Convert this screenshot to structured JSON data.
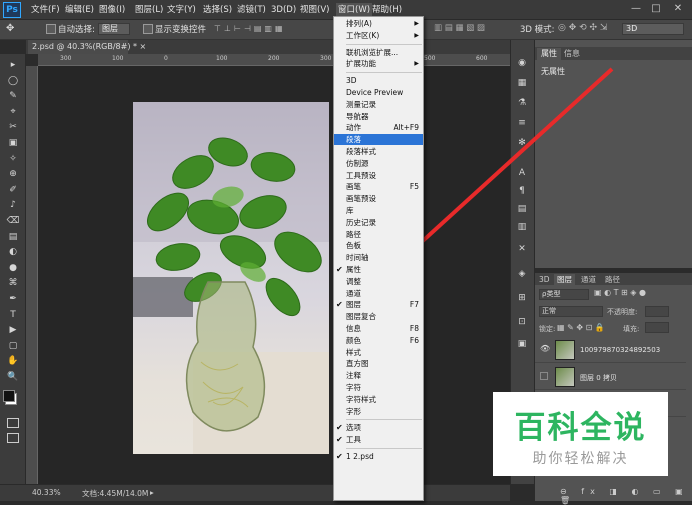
{
  "app": {
    "logo": "Ps"
  },
  "menubar": {
    "items": [
      "文件(F)",
      "编辑(E)",
      "图像(I)",
      "图层(L)",
      "文字(Y)",
      "选择(S)",
      "滤镜(T)",
      "3D(D)",
      "视图(V)",
      "窗口(W)",
      "帮助(H)"
    ],
    "active_index": 9,
    "controls": [
      "—",
      "□",
      "✕"
    ]
  },
  "options_bar": {
    "auto_select_label": "自动选择:",
    "auto_select_value": "图层",
    "show_transform_label": "显示变换控件",
    "mode_3d_label": "3D 模式:",
    "workspace_value": "3D"
  },
  "document": {
    "tab_label": "2.psd @ 40.3%(RGB/8#) *",
    "tab_close": "×",
    "ruler_ticks": [
      "300",
      "100",
      "0",
      "100",
      "200",
      "300",
      "400",
      "500",
      "600"
    ]
  },
  "status": {
    "zoom": "40.33%",
    "doc_info": "文档:4.45M/14.0M"
  },
  "toolbox": {
    "icons": [
      "▸",
      "◯",
      "✎",
      "⌖",
      "✂",
      "▣",
      "✧",
      "⊕",
      "✐",
      "♪",
      "⌫",
      "▤",
      "◐",
      "●",
      "⌘",
      "✒",
      "T",
      "▶",
      "▢",
      "✋",
      "🔍"
    ]
  },
  "panel_strip": {
    "icons": [
      "◉",
      "▦",
      "⚗",
      "≡",
      "✻",
      "A",
      "¶",
      "▤",
      "▥",
      "✕",
      "◈",
      "⊞",
      "⊡",
      "▣"
    ]
  },
  "properties": {
    "tabs": [
      "属性",
      "信息"
    ],
    "active_tab": 0,
    "content": "无属性"
  },
  "layers": {
    "tabs": [
      "3D",
      "图层",
      "通道",
      "路径"
    ],
    "active_tab": 1,
    "filter_label": "ρ类型",
    "blend_mode": "正常",
    "opacity_label": "不透明度:",
    "lock_label": "锁定:",
    "fill_label": "填充:",
    "rows": [
      {
        "name": "100979870324892503",
        "visible": true
      },
      {
        "name": "图层 0 拷贝",
        "visible": false
      },
      {
        "name": "",
        "visible": false
      }
    ],
    "footer_icons": [
      "⊖",
      "fx",
      "◨",
      "◐",
      "▭",
      "▣",
      "🗑"
    ]
  },
  "window_menu": {
    "items": [
      {
        "label": "排列(A)",
        "shortcut": "",
        "submenu": true,
        "checked": false,
        "highlight": false
      },
      {
        "label": "工作区(K)",
        "shortcut": "",
        "submenu": true,
        "checked": false,
        "highlight": false
      },
      {
        "sep": true
      },
      {
        "label": "联机浏览扩展...",
        "shortcut": "",
        "submenu": false,
        "checked": false,
        "highlight": false
      },
      {
        "label": "扩展功能",
        "shortcut": "",
        "submenu": true,
        "checked": false,
        "highlight": false
      },
      {
        "sep": true
      },
      {
        "label": "3D",
        "shortcut": "",
        "submenu": false,
        "checked": false,
        "highlight": false
      },
      {
        "label": "Device Preview",
        "shortcut": "",
        "submenu": false,
        "checked": false,
        "highlight": false
      },
      {
        "label": "测量记录",
        "shortcut": "",
        "submenu": false,
        "checked": false,
        "highlight": false
      },
      {
        "label": "导航器",
        "shortcut": "",
        "submenu": false,
        "checked": false,
        "highlight": false
      },
      {
        "label": "动作",
        "shortcut": "Alt+F9",
        "submenu": false,
        "checked": false,
        "highlight": false
      },
      {
        "label": "段落",
        "shortcut": "",
        "submenu": false,
        "checked": false,
        "highlight": true
      },
      {
        "label": "段落样式",
        "shortcut": "",
        "submenu": false,
        "checked": false,
        "highlight": false
      },
      {
        "label": "仿制源",
        "shortcut": "",
        "submenu": false,
        "checked": false,
        "highlight": false
      },
      {
        "label": "工具预设",
        "shortcut": "",
        "submenu": false,
        "checked": false,
        "highlight": false
      },
      {
        "label": "画笔",
        "shortcut": "F5",
        "submenu": false,
        "checked": false,
        "highlight": false
      },
      {
        "label": "画笔预设",
        "shortcut": "",
        "submenu": false,
        "checked": false,
        "highlight": false
      },
      {
        "label": "库",
        "shortcut": "",
        "submenu": false,
        "checked": false,
        "highlight": false
      },
      {
        "label": "历史记录",
        "shortcut": "",
        "submenu": false,
        "checked": false,
        "highlight": false
      },
      {
        "label": "路径",
        "shortcut": "",
        "submenu": false,
        "checked": false,
        "highlight": false
      },
      {
        "label": "色板",
        "shortcut": "",
        "submenu": false,
        "checked": false,
        "highlight": false
      },
      {
        "label": "时间轴",
        "shortcut": "",
        "submenu": false,
        "checked": false,
        "highlight": false
      },
      {
        "label": "属性",
        "shortcut": "",
        "submenu": false,
        "checked": true,
        "highlight": false
      },
      {
        "label": "调整",
        "shortcut": "",
        "submenu": false,
        "checked": false,
        "highlight": false
      },
      {
        "label": "通道",
        "shortcut": "",
        "submenu": false,
        "checked": false,
        "highlight": false
      },
      {
        "label": "图层",
        "shortcut": "F7",
        "submenu": false,
        "checked": true,
        "highlight": false
      },
      {
        "label": "图层复合",
        "shortcut": "",
        "submenu": false,
        "checked": false,
        "highlight": false
      },
      {
        "label": "信息",
        "shortcut": "F8",
        "submenu": false,
        "checked": false,
        "highlight": false
      },
      {
        "label": "颜色",
        "shortcut": "F6",
        "submenu": false,
        "checked": false,
        "highlight": false
      },
      {
        "label": "样式",
        "shortcut": "",
        "submenu": false,
        "checked": false,
        "highlight": false
      },
      {
        "label": "直方图",
        "shortcut": "",
        "submenu": false,
        "checked": false,
        "highlight": false
      },
      {
        "label": "注释",
        "shortcut": "",
        "submenu": false,
        "checked": false,
        "highlight": false
      },
      {
        "label": "字符",
        "shortcut": "",
        "submenu": false,
        "checked": false,
        "highlight": false
      },
      {
        "label": "字符样式",
        "shortcut": "",
        "submenu": false,
        "checked": false,
        "highlight": false
      },
      {
        "label": "字形",
        "shortcut": "",
        "submenu": false,
        "checked": false,
        "highlight": false
      },
      {
        "sep": true
      },
      {
        "label": "选项",
        "shortcut": "",
        "submenu": false,
        "checked": true,
        "highlight": false
      },
      {
        "label": "工具",
        "shortcut": "",
        "submenu": false,
        "checked": true,
        "highlight": false
      },
      {
        "sep": true
      },
      {
        "label": "1 2.psd",
        "shortcut": "",
        "submenu": false,
        "checked": true,
        "highlight": false
      }
    ]
  },
  "watermark": {
    "title": "百科全说",
    "subtitle": "助你轻松解决",
    "title_color": "#2db560",
    "subtitle_color": "#9a9a9a"
  },
  "annotation": {
    "arrow_color": "#e82a2a"
  }
}
